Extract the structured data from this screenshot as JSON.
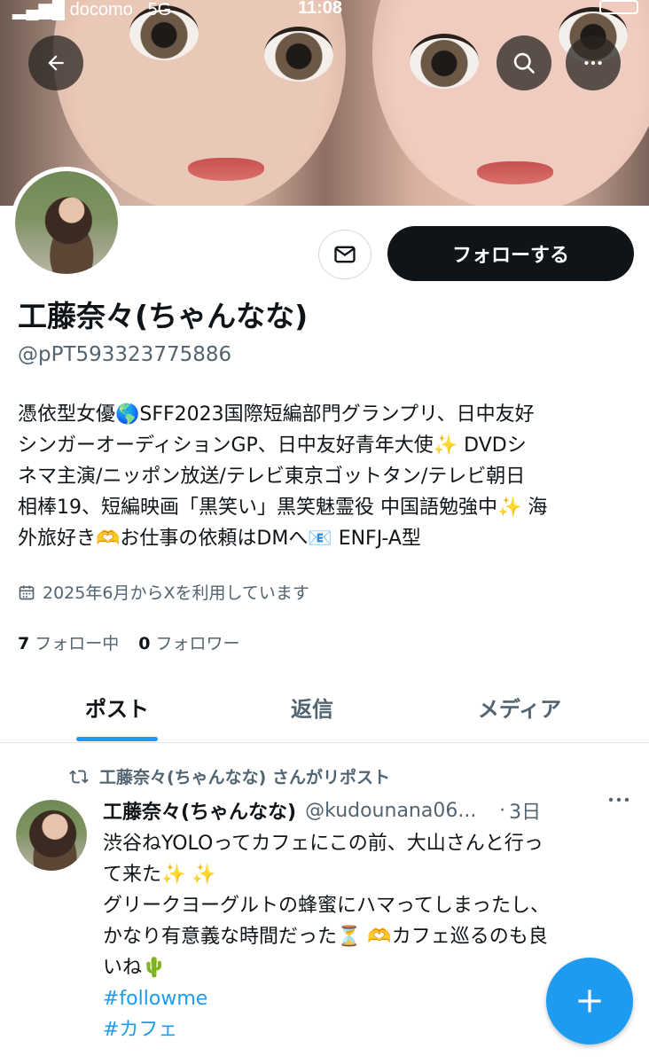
{
  "status_bar": {
    "carrier": "docomo",
    "network": "5G",
    "time": "11:08"
  },
  "profile": {
    "display_name": "工藤奈々(ちゃんなな)",
    "handle": "@pPT593323775886",
    "follow_label": "フォローする",
    "bio_lines": [
      "憑依型女優🌎SFF2023国際短編部門グランプリ、日中友好",
      "シンガーオーディションGP、日中友好青年大使✨ DVDシ",
      "ネマ主演/ニッポン放送/テレビ東京ゴットタン/テレビ朝日",
      "相棒19、短編映画「黒笑い」黒笑魅霊役 中国語勉強中✨ 海",
      "外旅好き🫶お仕事の依頼はDMへ📧 ENFJ-A型"
    ],
    "joined": "2025年6月からXを利用しています",
    "following_count": "7",
    "following_label": "フォロー中",
    "followers_count": "0",
    "followers_label": "フォロワー"
  },
  "tabs": [
    {
      "label": "ポスト",
      "active": true
    },
    {
      "label": "返信",
      "active": false
    },
    {
      "label": "メディア",
      "active": false
    }
  ],
  "post": {
    "repost_text": "工藤奈々(ちゃんなな) さんがリポスト",
    "author": "工藤奈々(ちゃんなな)",
    "handle": "@kudounana06...",
    "dot": "·",
    "time": "3日",
    "body_lines": [
      "渋谷ねYOLOってカフェにこの前、大山さんと行っ",
      "て来た✨ ✨",
      "グリークヨーグルトの蜂蜜にハマってしまったし、",
      "かなり有意義な時間だった⏳ 🫶カフェ巡るのも良",
      "いね🌵"
    ],
    "hashtags": [
      "#followme",
      "#カフェ"
    ]
  },
  "colors": {
    "accent": "#1d9bf0",
    "text": "#0f1419",
    "muted": "#536471",
    "follow_button": "#0f1419"
  },
  "icons": [
    "back-arrow-icon",
    "search-icon",
    "more-icon",
    "mail-icon",
    "calendar-icon",
    "repost-icon",
    "plus-icon"
  ]
}
